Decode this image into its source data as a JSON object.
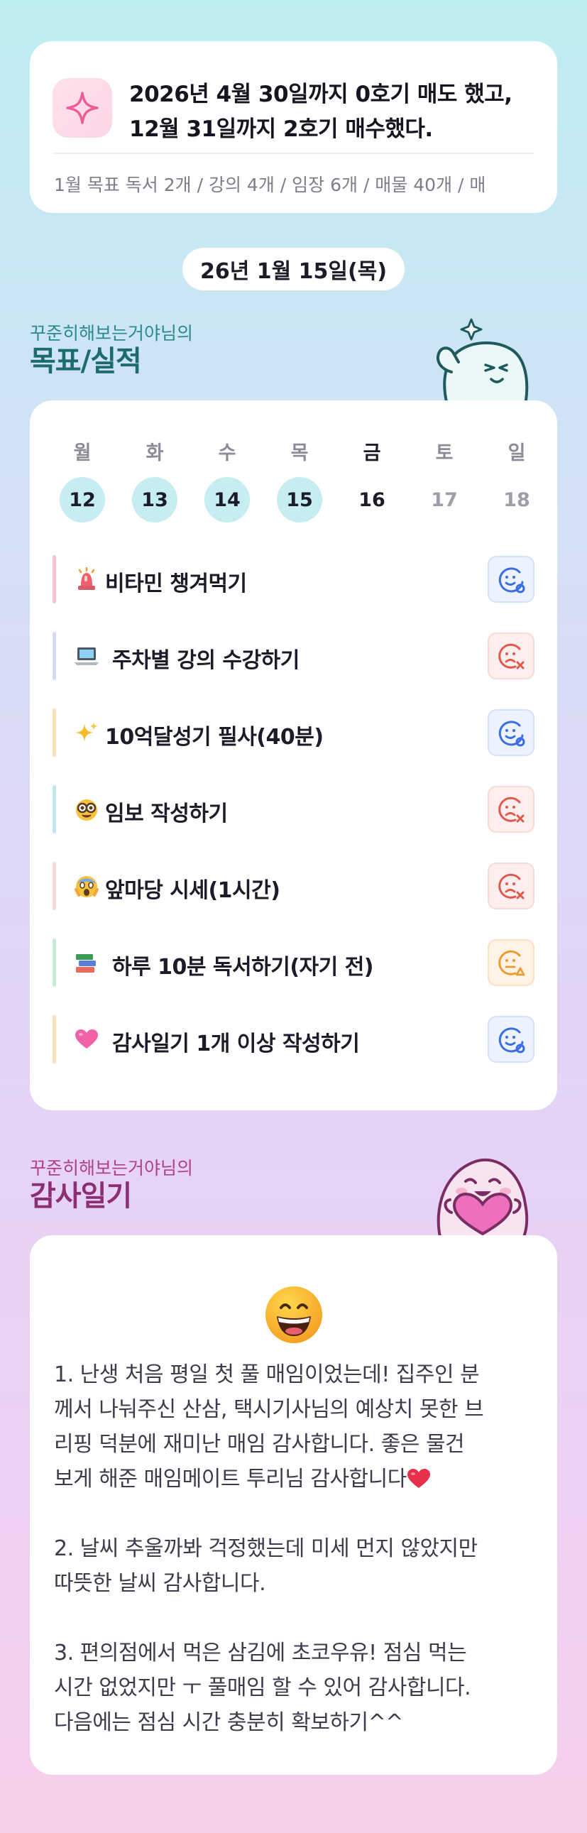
{
  "goal": {
    "line1": "2026년 4월 30일까지 0호기 매도 했고,",
    "line2": "12월 31일까지 2호기 매수했다.",
    "summary": "1월 목표  독서 2개 / 강의 4개 / 임장 6개 / 매물 40개 / 매",
    "icon": "sparkle-icon"
  },
  "date_label": "26년 1월 15일(목)",
  "goals_section": {
    "subtitle": "꾸준히해보는거야님의",
    "title": "목표/실적",
    "subtitle_color": "#2a8a8a",
    "title_color": "#1e6b6b"
  },
  "week": {
    "days": [
      {
        "name": "월",
        "num": "12",
        "state": "done"
      },
      {
        "name": "화",
        "num": "13",
        "state": "done"
      },
      {
        "name": "수",
        "num": "14",
        "state": "done"
      },
      {
        "name": "목",
        "num": "15",
        "state": "done"
      },
      {
        "name": "금",
        "num": "16",
        "state": "today"
      },
      {
        "name": "토",
        "num": "17",
        "state": "future"
      },
      {
        "name": "일",
        "num": "18",
        "state": "future"
      }
    ]
  },
  "habits": [
    {
      "label": "비타민 챙겨먹기",
      "icon": "siren-icon",
      "bar_color": "#f6c3d7",
      "status": "ok"
    },
    {
      "label": "주차별 강의 수강하기",
      "icon": "laptop-icon",
      "bar_color": "#d5dcf5",
      "status": "fail"
    },
    {
      "label": "10억달성기 필사(40분)",
      "icon": "sparkles-icon",
      "bar_color": "#f7e3b5",
      "status": "ok"
    },
    {
      "label": "임보 작성하기",
      "icon": "nerd-face-icon",
      "bar_color": "#bfe8ef",
      "status": "fail"
    },
    {
      "label": "앞마당 시세(1시간)",
      "icon": "scream-face-icon",
      "bar_color": "#f8d9d6",
      "status": "fail"
    },
    {
      "label": "하루 10분 독서하기(자기 전)",
      "icon": "books-icon",
      "bar_color": "#c4ecd9",
      "status": "partial"
    },
    {
      "label": "감사일기 1개 이상 작성하기",
      "icon": "pink-heart-icon",
      "bar_color": "#f8e3bb",
      "status": "ok"
    }
  ],
  "status_colors": {
    "ok": "#3b6fe0",
    "fail": "#e0584e",
    "partial": "#ee9a32"
  },
  "journal_section": {
    "subtitle": "꾸준히해보는거야님의",
    "title": "감사일기",
    "subtitle_color": "#b0408c",
    "title_color": "#8c2f72"
  },
  "journal": {
    "emoji": "grinning-face-icon",
    "entry1_line1": "1. 난생 처음 평일 첫 풀 매임이었는데! 집주인 분",
    "entry1_line2": "께서 나눠주신 산삼, 택시기사님의 예상치 못한 브",
    "entry1_line3": "리핑 덕분에 재미난 매임 감사합니다. 좋은 물건",
    "entry1_line4": "보게 해준 매임메이트 투리님 감사합니다",
    "entry2_line1": "2. 날씨 추울까봐 걱정했는데 미세 먼지 않았지만",
    "entry2_line2": "따뜻한 날씨 감사합니다.",
    "entry3_line1": "3. 편의점에서 먹은 삼김에 초코우유! 점심 먹는",
    "entry3_line2": "시간 없었지만 ㅜ 풀매임 할 수 있어 감사합니다.",
    "entry3_line3": "다음에는 점심 시간 충분히 확보하기^^"
  }
}
